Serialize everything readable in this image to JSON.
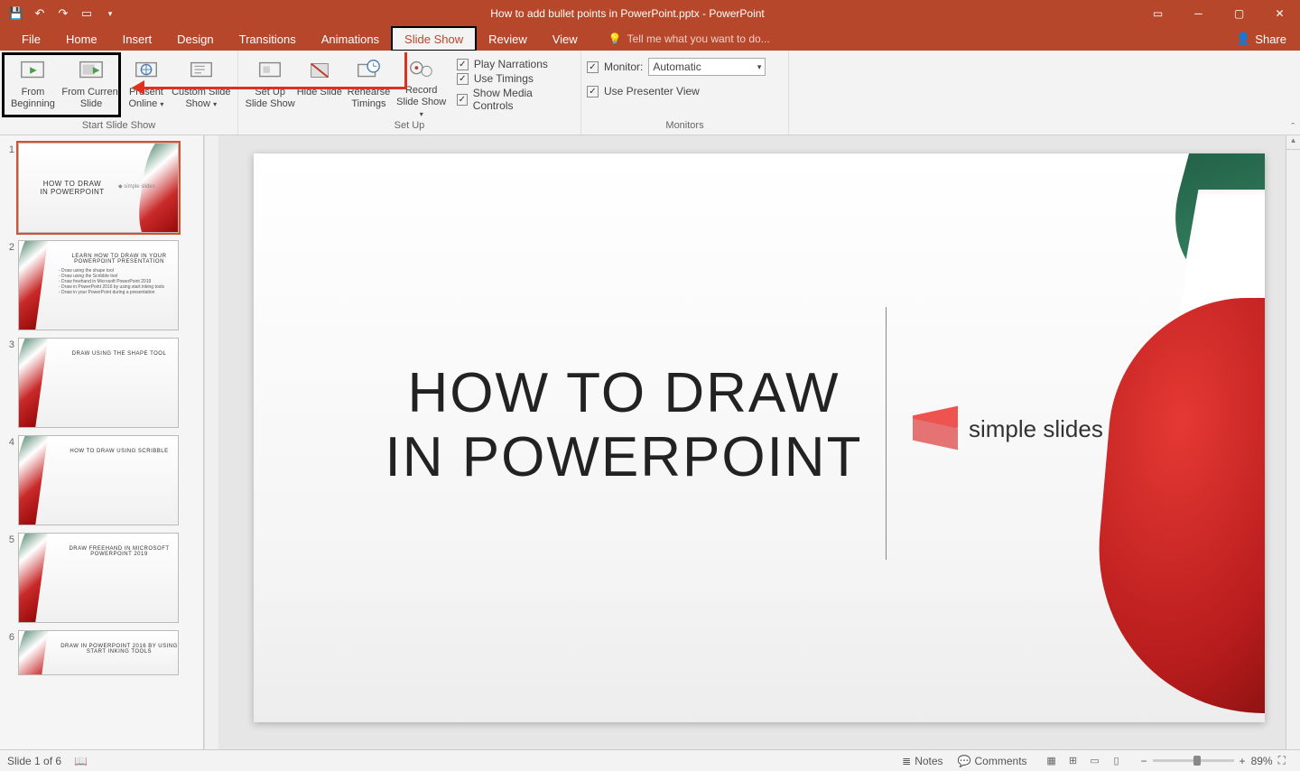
{
  "title_bar": {
    "document_title": "How to add bullet points in PowerPoint.pptx - PowerPoint"
  },
  "tabs": {
    "file": "File",
    "home": "Home",
    "insert": "Insert",
    "design": "Design",
    "transitions": "Transitions",
    "animations": "Animations",
    "slide_show": "Slide Show",
    "review": "Review",
    "view": "View",
    "tell_me": "Tell me what you want to do...",
    "share": "Share"
  },
  "ribbon": {
    "start_group": {
      "from_beginning": "From Beginning",
      "from_current": "From Current Slide",
      "present_online": "Present Online",
      "custom": "Custom Slide Show",
      "label": "Start Slide Show"
    },
    "setup_group": {
      "setup": "Set Up Slide Show",
      "hide": "Hide Slide",
      "rehearse": "Rehearse Timings",
      "record": "Record Slide Show",
      "play_narrations": "Play Narrations",
      "use_timings": "Use Timings",
      "show_media": "Show Media Controls",
      "label": "Set Up"
    },
    "monitors_group": {
      "monitor_label": "Monitor:",
      "monitor_value": "Automatic",
      "presenter_view": "Use Presenter View",
      "label": "Monitors"
    }
  },
  "thumbnails": [
    {
      "n": "1",
      "title": "HOW TO DRAW\nIN POWERPOINT",
      "type": "title"
    },
    {
      "n": "2",
      "title": "LEARN HOW TO DRAW IN YOUR POWERPOINT PRESENTATION",
      "type": "list"
    },
    {
      "n": "3",
      "title": "DRAW USING THE SHAPE TOOL",
      "type": "section"
    },
    {
      "n": "4",
      "title": "HOW TO DRAW USING SCRIBBLE",
      "type": "section"
    },
    {
      "n": "5",
      "title": "DRAW FREEHAND IN MICROSOFT POWERPOINT 2019",
      "type": "section"
    },
    {
      "n": "6",
      "title": "DRAW IN POWERPOINT 2016 BY USING START INKING TOOLS",
      "type": "section"
    }
  ],
  "slide": {
    "title_line1": "HOW TO DRAW",
    "title_line2": "IN POWERPOINT",
    "logo_text": "simple slides"
  },
  "status": {
    "slide_count": "Slide 1 of 6",
    "notes": "Notes",
    "comments": "Comments",
    "zoom": "89%"
  }
}
